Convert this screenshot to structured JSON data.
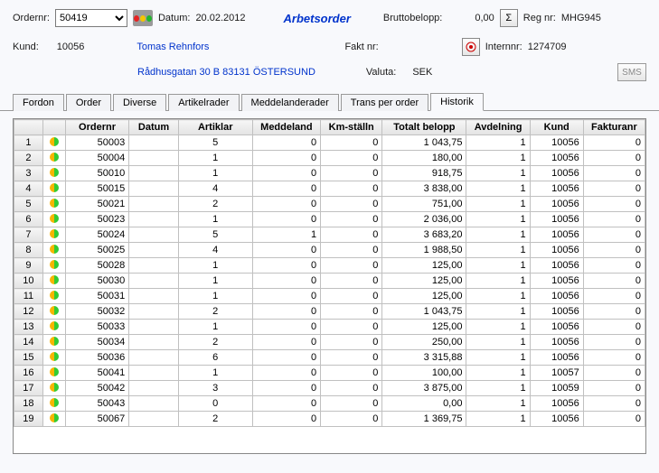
{
  "header": {
    "ordernr_label": "Ordernr:",
    "ordernr_value": "50419",
    "datum_label": "Datum:",
    "datum_value": "20.02.2012",
    "title": "Arbetsorder",
    "brutto_label": "Bruttobelopp:",
    "brutto_value": "0,00",
    "regnr_label": "Reg nr:",
    "regnr_value": "MHG945",
    "kund_label": "Kund:",
    "kund_value": "10056",
    "kund_name": "Tomas Rehnfors",
    "faktnr_label": "Fakt nr:",
    "internnr_label": "Internnr:",
    "internnr_value": "1274709",
    "address": "Rådhusgatan 30 B 83131 ÖSTERSUND",
    "valuta_label": "Valuta:",
    "valuta_value": "SEK",
    "sms": "SMS",
    "sigma": "Σ"
  },
  "tabs": [
    {
      "label": "Fordon"
    },
    {
      "label": "Order"
    },
    {
      "label": "Diverse"
    },
    {
      "label": "Artikelrader"
    },
    {
      "label": "Meddelanderader"
    },
    {
      "label": "Trans per order"
    },
    {
      "label": "Historik"
    }
  ],
  "grid": {
    "headers": [
      "",
      "",
      "Ordernr",
      "Datum",
      "Artiklar",
      "Meddeland",
      "Km-ställn",
      "Totalt belopp",
      "Avdelning",
      "Kund",
      "Fakturanr"
    ],
    "rows": [
      {
        "n": 1,
        "ordernr": "50003",
        "datum": "",
        "art": "5",
        "medd": "0",
        "km": "0",
        "tot": "1 043,75",
        "avd": "1",
        "kund": "10056",
        "fakt": "0"
      },
      {
        "n": 2,
        "ordernr": "50004",
        "datum": "",
        "art": "1",
        "medd": "0",
        "km": "0",
        "tot": "180,00",
        "avd": "1",
        "kund": "10056",
        "fakt": "0"
      },
      {
        "n": 3,
        "ordernr": "50010",
        "datum": "",
        "art": "1",
        "medd": "0",
        "km": "0",
        "tot": "918,75",
        "avd": "1",
        "kund": "10056",
        "fakt": "0"
      },
      {
        "n": 4,
        "ordernr": "50015",
        "datum": "",
        "art": "4",
        "medd": "0",
        "km": "0",
        "tot": "3 838,00",
        "avd": "1",
        "kund": "10056",
        "fakt": "0"
      },
      {
        "n": 5,
        "ordernr": "50021",
        "datum": "",
        "art": "2",
        "medd": "0",
        "km": "0",
        "tot": "751,00",
        "avd": "1",
        "kund": "10056",
        "fakt": "0"
      },
      {
        "n": 6,
        "ordernr": "50023",
        "datum": "",
        "art": "1",
        "medd": "0",
        "km": "0",
        "tot": "2 036,00",
        "avd": "1",
        "kund": "10056",
        "fakt": "0"
      },
      {
        "n": 7,
        "ordernr": "50024",
        "datum": "",
        "art": "5",
        "medd": "1",
        "km": "0",
        "tot": "3 683,20",
        "avd": "1",
        "kund": "10056",
        "fakt": "0"
      },
      {
        "n": 8,
        "ordernr": "50025",
        "datum": "",
        "art": "4",
        "medd": "0",
        "km": "0",
        "tot": "1 988,50",
        "avd": "1",
        "kund": "10056",
        "fakt": "0"
      },
      {
        "n": 9,
        "ordernr": "50028",
        "datum": "",
        "art": "1",
        "medd": "0",
        "km": "0",
        "tot": "125,00",
        "avd": "1",
        "kund": "10056",
        "fakt": "0"
      },
      {
        "n": 10,
        "ordernr": "50030",
        "datum": "",
        "art": "1",
        "medd": "0",
        "km": "0",
        "tot": "125,00",
        "avd": "1",
        "kund": "10056",
        "fakt": "0"
      },
      {
        "n": 11,
        "ordernr": "50031",
        "datum": "",
        "art": "1",
        "medd": "0",
        "km": "0",
        "tot": "125,00",
        "avd": "1",
        "kund": "10056",
        "fakt": "0"
      },
      {
        "n": 12,
        "ordernr": "50032",
        "datum": "",
        "art": "2",
        "medd": "0",
        "km": "0",
        "tot": "1 043,75",
        "avd": "1",
        "kund": "10056",
        "fakt": "0"
      },
      {
        "n": 13,
        "ordernr": "50033",
        "datum": "",
        "art": "1",
        "medd": "0",
        "km": "0",
        "tot": "125,00",
        "avd": "1",
        "kund": "10056",
        "fakt": "0"
      },
      {
        "n": 14,
        "ordernr": "50034",
        "datum": "",
        "art": "2",
        "medd": "0",
        "km": "0",
        "tot": "250,00",
        "avd": "1",
        "kund": "10056",
        "fakt": "0"
      },
      {
        "n": 15,
        "ordernr": "50036",
        "datum": "",
        "art": "6",
        "medd": "0",
        "km": "0",
        "tot": "3 315,88",
        "avd": "1",
        "kund": "10056",
        "fakt": "0"
      },
      {
        "n": 16,
        "ordernr": "50041",
        "datum": "",
        "art": "1",
        "medd": "0",
        "km": "0",
        "tot": "100,00",
        "avd": "1",
        "kund": "10057",
        "fakt": "0"
      },
      {
        "n": 17,
        "ordernr": "50042",
        "datum": "",
        "art": "3",
        "medd": "0",
        "km": "0",
        "tot": "3 875,00",
        "avd": "1",
        "kund": "10059",
        "fakt": "0"
      },
      {
        "n": 18,
        "ordernr": "50043",
        "datum": "",
        "art": "0",
        "medd": "0",
        "km": "0",
        "tot": "0,00",
        "avd": "1",
        "kund": "10056",
        "fakt": "0"
      },
      {
        "n": 19,
        "ordernr": "50067",
        "datum": "",
        "art": "2",
        "medd": "0",
        "km": "0",
        "tot": "1 369,75",
        "avd": "1",
        "kund": "10056",
        "fakt": "0"
      }
    ]
  }
}
